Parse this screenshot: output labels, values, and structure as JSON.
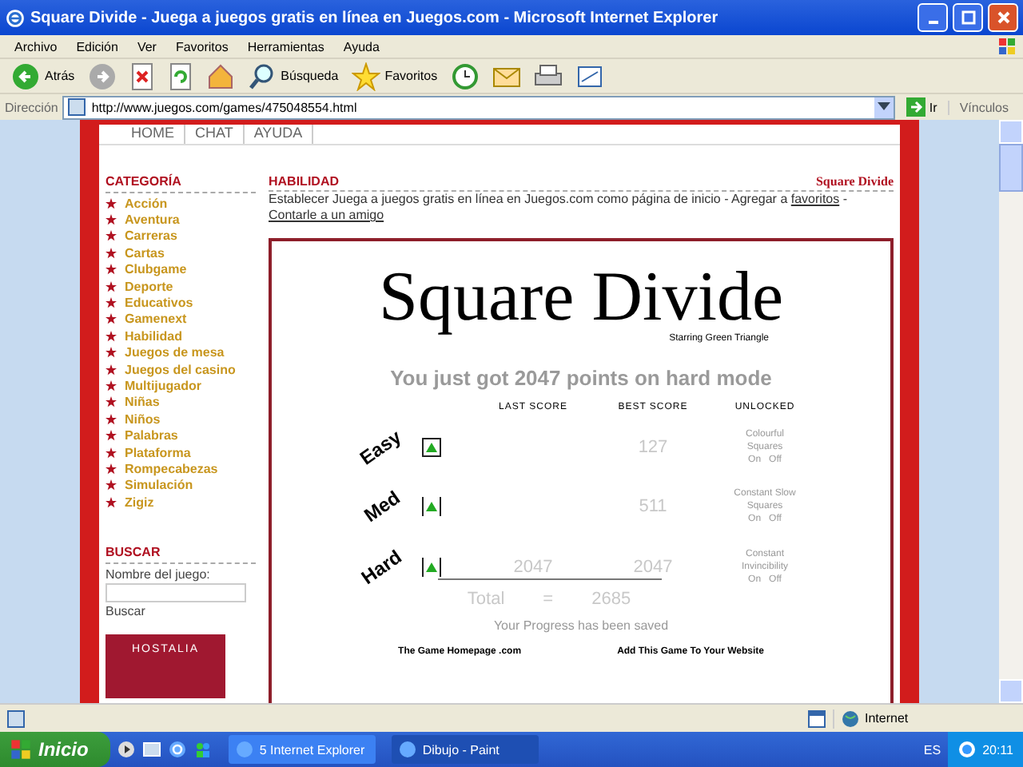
{
  "window": {
    "title": "Square Divide - Juega a juegos gratis en línea en Juegos.com - Microsoft Internet Explorer"
  },
  "menu": [
    "Archivo",
    "Edición",
    "Ver",
    "Favoritos",
    "Herramientas",
    "Ayuda"
  ],
  "toolbar": [
    {
      "kind": "back",
      "label": "Atrás"
    },
    {
      "kind": "forward"
    },
    {
      "kind": "stop"
    },
    {
      "kind": "refresh"
    },
    {
      "kind": "home"
    },
    {
      "kind": "search",
      "label": "Búsqueda"
    },
    {
      "kind": "favorites",
      "label": "Favoritos"
    },
    {
      "kind": "history"
    },
    {
      "kind": "mail"
    },
    {
      "kind": "print"
    },
    {
      "kind": "edit"
    }
  ],
  "address_bar": {
    "label": "Dirección",
    "value": "http://www.juegos.com/games/475048554.html",
    "go": "Ir",
    "links": "Vínculos"
  },
  "site_nav": [
    "HOME",
    "CHAT",
    "AYUDA"
  ],
  "sidebar": {
    "heading": "CATEGORÍA",
    "items": [
      "Acción",
      "Aventura",
      "Carreras",
      "Cartas",
      "Clubgame",
      "Deporte",
      "Educativos",
      "Gamenext",
      "Habilidad",
      "Juegos de mesa",
      "Juegos del casino",
      "Multijugador",
      "Niñas",
      "Niños",
      "Palabras",
      "Plataforma",
      "Rompecabezas",
      "Simulación",
      "Zigiz"
    ],
    "search_heading": "BUSCAR",
    "search_label": "Nombre del juego:",
    "search_button": "Buscar",
    "ad_text": "HOSTALIA"
  },
  "main": {
    "category": "HABILIDAD",
    "game_title": "Square Divide",
    "intro": "Establecer Juega a juegos gratis en línea en Juegos.com como página de inicio - Agregar a",
    "links": [
      "favoritos",
      "Contarle a un amigo"
    ],
    "link_separator": "-"
  },
  "game": {
    "title": "Square Divide",
    "subtitle": "Starring Green Triangle",
    "message": "You just got 2047 points on hard mode",
    "columns": [
      "LAST SCORE",
      "BEST SCORE",
      "UNLOCKED"
    ],
    "rows": [
      {
        "mode": "Easy",
        "best_score": "127",
        "unlocked": "Colourful Squares",
        "on": "On",
        "off": "Off",
        "framed": true
      },
      {
        "mode": "Med",
        "best_score": "511",
        "unlocked": "Constant Slow Squares",
        "on": "On",
        "off": "Off",
        "framed": false
      },
      {
        "mode": "Hard",
        "last_score": "2047",
        "best_score": "2047",
        "unlocked": "Constant Invincibility",
        "on": "On",
        "off": "Off",
        "framed": false
      }
    ],
    "total_label": "Total",
    "total_sign": "=",
    "total": "2685",
    "saved": "Your Progress has been saved",
    "footer_links": [
      "The Game Homepage .com",
      "Add This Game To Your Website"
    ]
  },
  "status_bar": {
    "zone": "Internet"
  },
  "taskbar": {
    "start": "Inicio",
    "tasks": [
      {
        "label": "5 Internet Explorer",
        "selected": false
      },
      {
        "label": "Dibujo - Paint",
        "selected": true
      }
    ],
    "lang": "ES",
    "time": "20:11"
  }
}
